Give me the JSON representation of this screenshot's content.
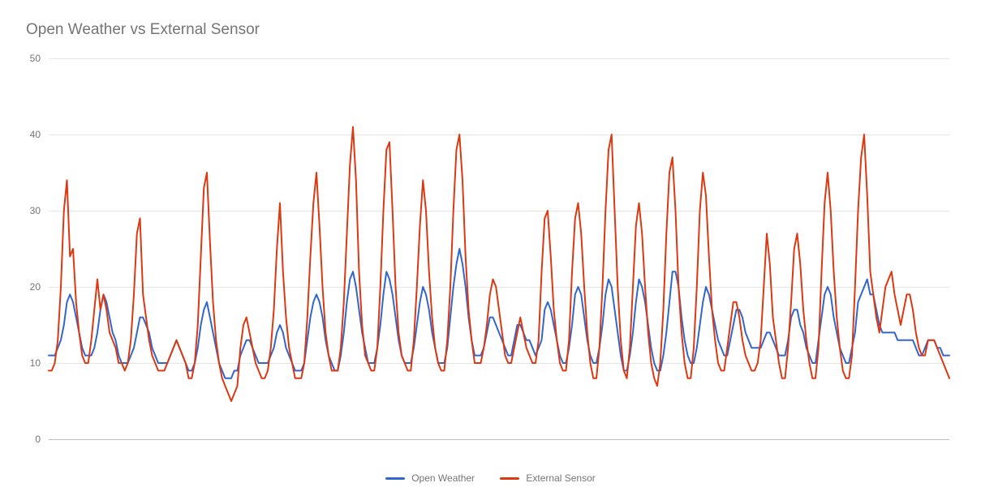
{
  "chart_data": {
    "type": "line",
    "title": "Open Weather vs External Sensor",
    "xlabel": "",
    "ylabel": "",
    "ylim": [
      0,
      50
    ],
    "yticks": [
      0,
      10,
      20,
      30,
      40,
      50
    ],
    "colors": {
      "open_weather": "#3366cc",
      "external_sensor": "#dc3912"
    },
    "n_points": 310,
    "series": [
      {
        "name": "Open Weather",
        "color": "#3366cc",
        "values": [
          11,
          11,
          11,
          12,
          13,
          15,
          18,
          19,
          18,
          16,
          14,
          12,
          11,
          11,
          11,
          12,
          14,
          17,
          19,
          18,
          16,
          14,
          13,
          11,
          10,
          10,
          10,
          11,
          12,
          14,
          16,
          16,
          15,
          14,
          12,
          11,
          10,
          10,
          10,
          10,
          11,
          12,
          13,
          12,
          11,
          10,
          9,
          9,
          10,
          12,
          15,
          17,
          18,
          16,
          14,
          12,
          10,
          9,
          8,
          8,
          8,
          9,
          9,
          11,
          12,
          13,
          13,
          12,
          11,
          10,
          10,
          10,
          10,
          11,
          12,
          14,
          15,
          14,
          12,
          11,
          10,
          9,
          9,
          9,
          10,
          13,
          16,
          18,
          19,
          18,
          16,
          13,
          11,
          10,
          9,
          9,
          11,
          14,
          18,
          21,
          22,
          20,
          17,
          14,
          12,
          10,
          10,
          10,
          12,
          15,
          19,
          22,
          21,
          19,
          16,
          13,
          11,
          10,
          10,
          10,
          12,
          15,
          18,
          20,
          19,
          17,
          14,
          12,
          10,
          10,
          10,
          12,
          16,
          20,
          23,
          25,
          23,
          20,
          16,
          13,
          11,
          11,
          11,
          12,
          14,
          16,
          16,
          15,
          14,
          13,
          12,
          11,
          11,
          13,
          15,
          15,
          14,
          13,
          13,
          12,
          11,
          12,
          13,
          17,
          18,
          17,
          15,
          13,
          11,
          10,
          10,
          12,
          15,
          19,
          20,
          19,
          16,
          13,
          11,
          10,
          10,
          12,
          15,
          19,
          21,
          20,
          17,
          14,
          11,
          9,
          9,
          11,
          14,
          18,
          21,
          20,
          18,
          15,
          12,
          10,
          9,
          9,
          11,
          14,
          18,
          22,
          22,
          20,
          16,
          13,
          11,
          10,
          10,
          12,
          15,
          18,
          20,
          19,
          17,
          15,
          13,
          12,
          11,
          11,
          13,
          15,
          17,
          17,
          16,
          14,
          13,
          12,
          12,
          12,
          12,
          13,
          14,
          14,
          13,
          12,
          11,
          11,
          11,
          13,
          16,
          17,
          17,
          15,
          14,
          12,
          11,
          10,
          10,
          13,
          16,
          19,
          20,
          19,
          16,
          14,
          12,
          11,
          10,
          10,
          12,
          14,
          18,
          19,
          20,
          21,
          19,
          19,
          17,
          15,
          14,
          14,
          14,
          14,
          14,
          13,
          13,
          13,
          13,
          13,
          13,
          12,
          11,
          11,
          12,
          13,
          13,
          13,
          12,
          12,
          11,
          11,
          11
        ]
      },
      {
        "name": "External Sensor",
        "color": "#dc3912",
        "values": [
          9,
          9,
          10,
          13,
          20,
          30,
          34,
          24,
          25,
          18,
          14,
          11,
          10,
          10,
          13,
          17,
          21,
          17,
          19,
          17,
          14,
          13,
          12,
          10,
          10,
          9,
          10,
          13,
          19,
          27,
          29,
          19,
          16,
          13,
          11,
          10,
          9,
          9,
          9,
          10,
          11,
          12,
          13,
          12,
          11,
          10,
          8,
          8,
          10,
          15,
          24,
          33,
          35,
          26,
          18,
          13,
          10,
          8,
          7,
          6,
          5,
          6,
          7,
          12,
          15,
          16,
          14,
          12,
          10,
          9,
          8,
          8,
          9,
          12,
          17,
          25,
          31,
          22,
          16,
          12,
          10,
          8,
          8,
          8,
          10,
          16,
          24,
          31,
          35,
          28,
          20,
          14,
          11,
          9,
          9,
          9,
          12,
          18,
          27,
          36,
          41,
          34,
          22,
          15,
          11,
          10,
          9,
          9,
          12,
          20,
          30,
          38,
          39,
          30,
          20,
          14,
          11,
          10,
          9,
          9,
          13,
          20,
          28,
          34,
          30,
          22,
          16,
          12,
          10,
          9,
          9,
          13,
          20,
          30,
          38,
          40,
          34,
          24,
          17,
          13,
          10,
          10,
          10,
          12,
          15,
          19,
          21,
          20,
          17,
          14,
          11,
          10,
          10,
          12,
          14,
          16,
          14,
          12,
          11,
          10,
          10,
          13,
          22,
          29,
          30,
          24,
          17,
          13,
          10,
          9,
          9,
          13,
          22,
          29,
          31,
          27,
          20,
          14,
          10,
          8,
          8,
          12,
          20,
          30,
          38,
          40,
          30,
          20,
          13,
          9,
          8,
          12,
          20,
          28,
          31,
          27,
          20,
          14,
          10,
          8,
          7,
          10,
          17,
          27,
          35,
          37,
          30,
          20,
          14,
          10,
          8,
          8,
          12,
          20,
          30,
          35,
          32,
          24,
          17,
          13,
          10,
          9,
          9,
          12,
          15,
          18,
          18,
          16,
          13,
          11,
          10,
          9,
          9,
          10,
          13,
          20,
          27,
          23,
          16,
          13,
          10,
          8,
          8,
          12,
          18,
          25,
          27,
          23,
          17,
          13,
          10,
          8,
          8,
          12,
          22,
          31,
          35,
          30,
          22,
          16,
          12,
          9,
          8,
          8,
          11,
          20,
          30,
          37,
          40,
          32,
          22,
          19,
          16,
          14,
          17,
          20,
          21,
          22,
          19,
          17,
          15,
          17,
          19,
          19,
          17,
          14,
          12,
          11,
          11,
          13,
          13,
          13,
          12,
          11,
          10,
          9,
          8
        ]
      }
    ]
  }
}
